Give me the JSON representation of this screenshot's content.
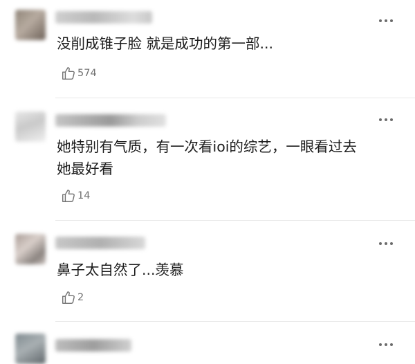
{
  "comments": [
    {
      "text": "没削成锥子脸 就是成功的第一部...",
      "likes": "574"
    },
    {
      "text": "她特别有气质，有一次看ioi的综艺，一眼看过去\n她最好看",
      "likes": "14"
    },
    {
      "text": "鼻子太自然了...羡慕",
      "likes": "2"
    },
    {
      "text": "",
      "likes": ""
    }
  ],
  "icons": {
    "more": "more-dots-icon",
    "like": "thumbs-up-icon"
  },
  "colors": {
    "text": "#1c1c1c",
    "icon": "#707070",
    "divider": "#e9e9e9"
  }
}
